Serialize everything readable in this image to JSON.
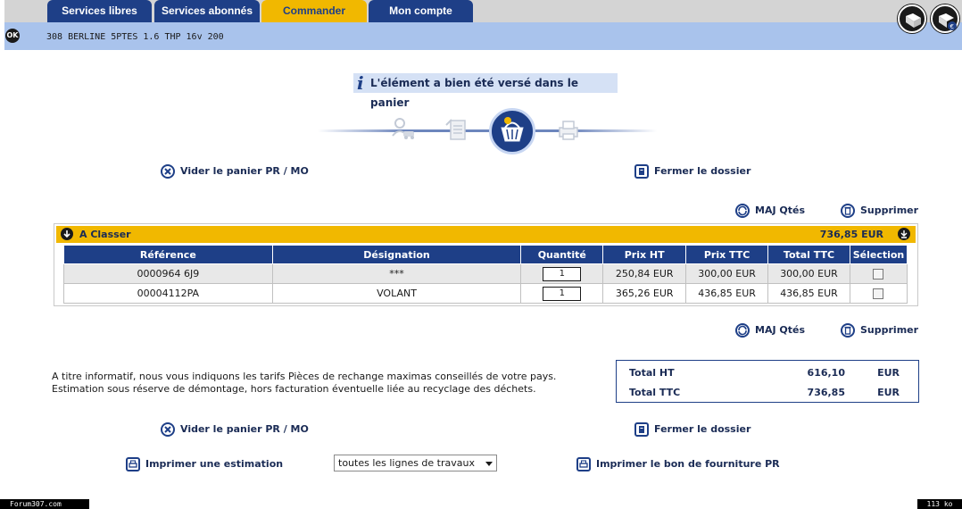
{
  "tabs": [
    {
      "label": "Services libres",
      "active": false
    },
    {
      "label": "Services abonnés",
      "active": false
    },
    {
      "label": "Commander",
      "active": true
    },
    {
      "label": "Mon compte",
      "active": false
    }
  ],
  "header": {
    "ok_label": "OK",
    "vehicle": "308 BERLINE 5PTES 1.6 THP 16v 200"
  },
  "notice": "L'élément a bien été versé dans le panier",
  "actions": {
    "empty_basket": "Vider le panier PR / MO",
    "close_file": "Fermer le dossier",
    "update_qty": "MAJ Qtés",
    "delete": "Supprimer",
    "print_estimate": "Imprimer une estimation",
    "print_supply": "Imprimer le bon de fourniture PR"
  },
  "basket": {
    "title": "A Classer",
    "total": "736,85 EUR",
    "columns": [
      "Référence",
      "Désignation",
      "Quantité",
      "Prix HT",
      "Prix TTC",
      "Total TTC",
      "Sélection"
    ],
    "rows": [
      {
        "reference": "0000964 6J9",
        "designation": "***",
        "quantity": "1",
        "price_ht": "250,84 EUR",
        "price_ttc": "300,00 EUR",
        "total_ttc": "300,00 EUR",
        "selected": false
      },
      {
        "reference": "00004112PA",
        "designation": "VOLANT",
        "quantity": "1",
        "price_ht": "365,26 EUR",
        "price_ttc": "436,85 EUR",
        "total_ttc": "436,85 EUR",
        "selected": false
      }
    ]
  },
  "info": {
    "line1": "A titre informatif, nous vous indiquons les tarifs Pièces de rechange maximas conseillés de votre pays.",
    "line2": "Estimation sous réserve de démontage, hors facturation éventuelle liée au recyclage des déchets."
  },
  "totals": {
    "ht_label": "Total HT",
    "ht_value": "616,10",
    "ht_currency": "EUR",
    "ttc_label": "Total TTC",
    "ttc_value": "736,85",
    "ttc_currency": "EUR"
  },
  "select": {
    "value": "toutes les lignes de travaux"
  },
  "footer": {
    "left": "Forum307.com",
    "right": "113 ko"
  },
  "colors": {
    "navy": "#1e3f87",
    "gold": "#f1b800",
    "light_blue": "#a9c3ec"
  }
}
